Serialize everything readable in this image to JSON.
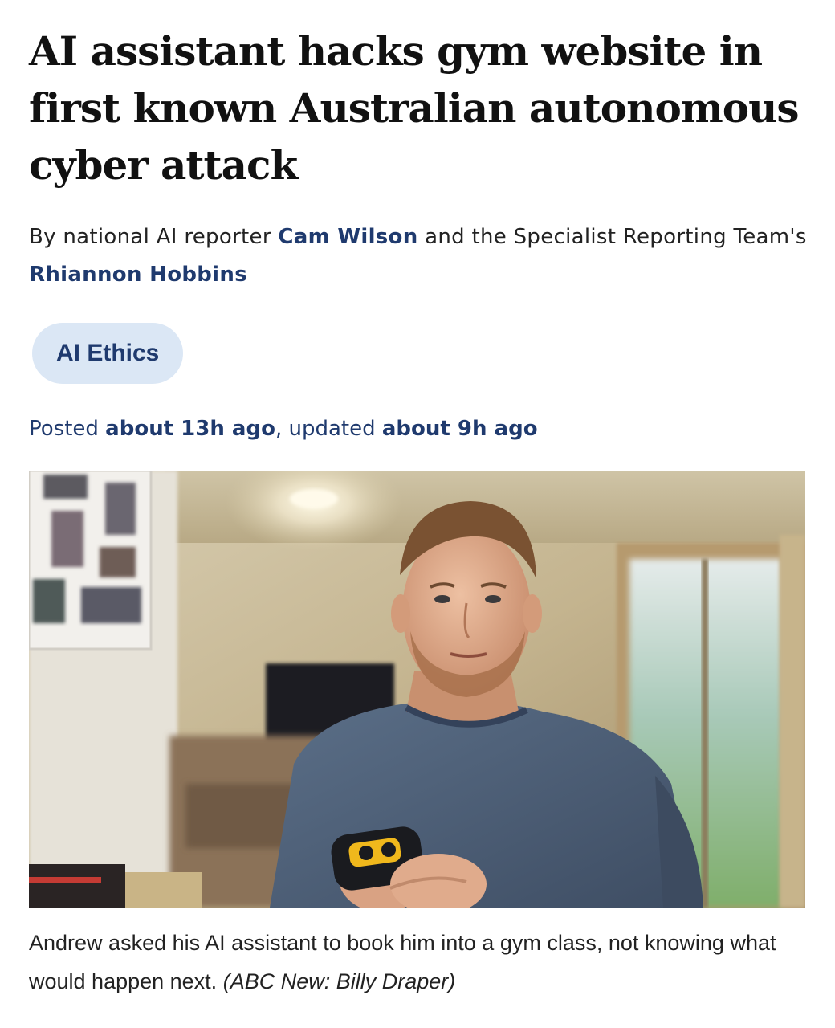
{
  "article": {
    "headline": "AI assistant hacks gym website in first known Australian autonomous cyber attack",
    "byline": {
      "prefix": "By national AI reporter ",
      "author1": "Cam Wilson",
      "middle": " and the Specialist Reporting Team's ",
      "author2": "Rhiannon Hobbins"
    },
    "tag": "AI Ethics",
    "timestamps": {
      "posted_label": "Posted ",
      "posted_value": "about 13h ago",
      "separator": ", updated ",
      "updated_value": "about 9h ago"
    },
    "image": {
      "caption": "Andrew asked his AI assistant to book him into a gym class, not knowing what would happen next.",
      "credit": "(ABC New: Billy Draper)"
    }
  },
  "colors": {
    "headline": "#111111",
    "link": "#1f3a6e",
    "tag_background": "#dbe7f5",
    "body_text": "#222222"
  }
}
